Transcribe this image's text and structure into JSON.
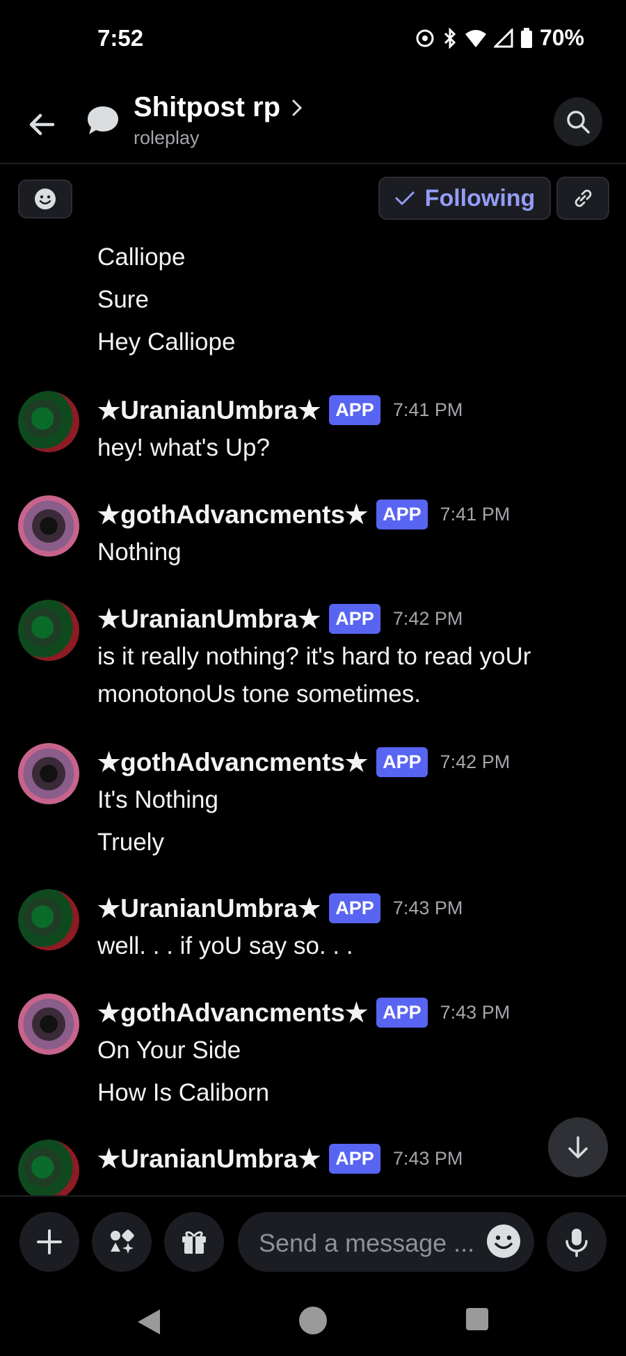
{
  "status_bar": {
    "time": "7:52",
    "battery": "70%"
  },
  "header": {
    "title": "Shitpost rp",
    "subtitle": "roleplay"
  },
  "thread_bar": {
    "following_label": "Following"
  },
  "top_messages": [
    "Calliope",
    "Sure",
    "Hey Calliope"
  ],
  "messages": [
    {
      "author": "★UranianUmbra★",
      "badge": "APP",
      "time": "7:41 PM",
      "lines": [
        "hey! what's Up?"
      ]
    },
    {
      "author": "★gothAdvancments★",
      "badge": "APP",
      "time": "7:41 PM",
      "lines": [
        "Nothing"
      ]
    },
    {
      "author": "★UranianUmbra★",
      "badge": "APP",
      "time": "7:42 PM",
      "lines": [
        "is it really nothing? it's hard to read yoUr",
        "monotonoUs tone sometimes."
      ]
    },
    {
      "author": "★gothAdvancments★",
      "badge": "APP",
      "time": "7:42 PM",
      "lines": [
        "It's Nothing",
        "Truely"
      ]
    },
    {
      "author": "★UranianUmbra★",
      "badge": "APP",
      "time": "7:43 PM",
      "lines": [
        "well. . . if yoU say so. . ."
      ]
    },
    {
      "author": "★gothAdvancments★",
      "badge": "APP",
      "time": "7:43 PM",
      "lines": [
        "On Your Side",
        "How Is Caliborn"
      ]
    },
    {
      "author": "★UranianUmbra★",
      "badge": "APP",
      "time": "7:43 PM",
      "lines": []
    }
  ],
  "composer": {
    "placeholder": "Send a message ..."
  },
  "colors": {
    "accent": "#5865f2",
    "following": "#949cf7",
    "background": "#000000"
  },
  "icons": [
    "back-arrow-icon",
    "chat-bubble-icon",
    "chevron-right-icon",
    "search-icon",
    "smiley-icon",
    "check-icon",
    "link-icon",
    "arrow-down-icon",
    "plus-icon",
    "apps-icon",
    "gift-icon",
    "microphone-icon",
    "nav-back-icon",
    "nav-home-icon",
    "nav-recents-icon"
  ]
}
